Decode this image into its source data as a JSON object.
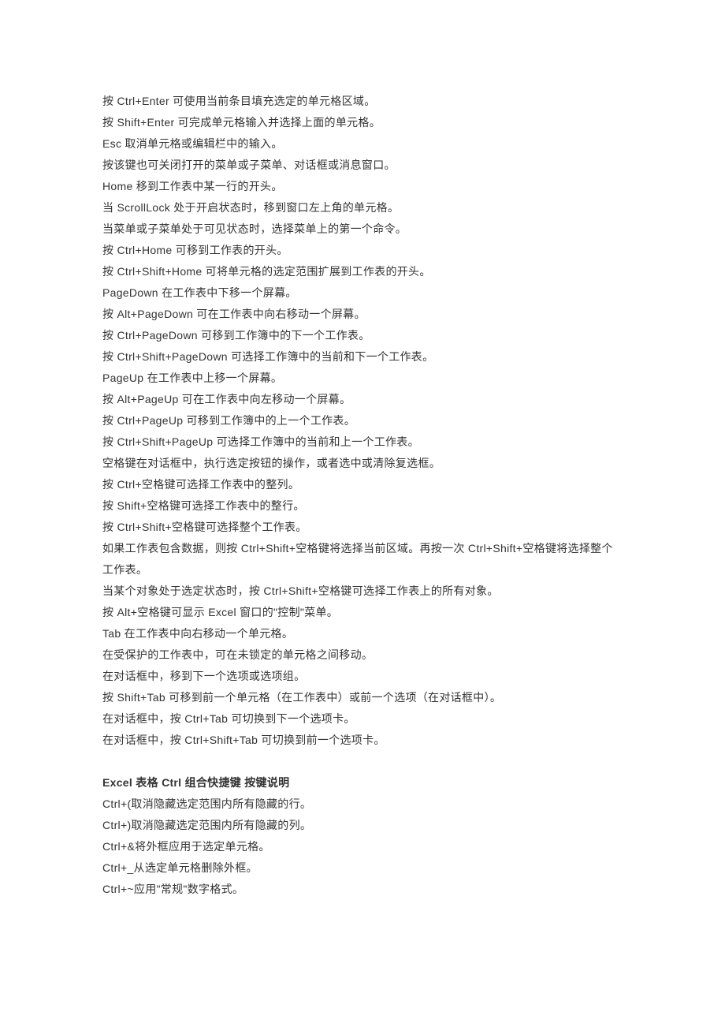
{
  "lines": [
    "按 Ctrl+Enter 可使用当前条目填充选定的单元格区域。",
    "按 Shift+Enter 可完成单元格输入并选择上面的单元格。",
    "Esc 取消单元格或编辑栏中的输入。",
    "按该键也可关闭打开的菜单或子菜单、对话框或消息窗口。",
    "Home 移到工作表中某一行的开头。",
    "当 ScrollLock 处于开启状态时，移到窗口左上角的单元格。",
    "当菜单或子菜单处于可见状态时，选择菜单上的第一个命令。",
    "按 Ctrl+Home 可移到工作表的开头。",
    "按 Ctrl+Shift+Home 可将单元格的选定范围扩展到工作表的开头。",
    "PageDown 在工作表中下移一个屏幕。",
    "按 Alt+PageDown 可在工作表中向右移动一个屏幕。",
    "按 Ctrl+PageDown 可移到工作簿中的下一个工作表。",
    "按 Ctrl+Shift+PageDown 可选择工作簿中的当前和下一个工作表。",
    "PageUp 在工作表中上移一个屏幕。",
    "按 Alt+PageUp 可在工作表中向左移动一个屏幕。",
    "按 Ctrl+PageUp 可移到工作簿中的上一个工作表。",
    "按 Ctrl+Shift+PageUp 可选择工作簿中的当前和上一个工作表。",
    "空格键在对话框中，执行选定按钮的操作，或者选中或清除复选框。",
    "按 Ctrl+空格键可选择工作表中的整列。",
    "按 Shift+空格键可选择工作表中的整行。",
    "按 Ctrl+Shift+空格键可选择整个工作表。",
    "如果工作表包含数据，则按 Ctrl+Shift+空格键将选择当前区域。再按一次 Ctrl+Shift+空格键将选择整个工作表。",
    "当某个对象处于选定状态时，按 Ctrl+Shift+空格键可选择工作表上的所有对象。",
    "按 Alt+空格键可显示 Excel 窗口的\"控制\"菜单。",
    "Tab 在工作表中向右移动一个单元格。",
    "在受保护的工作表中，可在未锁定的单元格之间移动。",
    "在对话框中，移到下一个选项或选项组。",
    "按 Shift+Tab 可移到前一个单元格（在工作表中）或前一个选项（在对话框中）。",
    "在对话框中，按 Ctrl+Tab 可切换到下一个选项卡。",
    "在对话框中，按 Ctrl+Shift+Tab 可切换到前一个选项卡。"
  ],
  "heading": "Excel 表格 Ctrl 组合快捷键 按键说明",
  "lines2": [
    "Ctrl+(取消隐藏选定范围内所有隐藏的行。",
    "Ctrl+)取消隐藏选定范围内所有隐藏的列。",
    "Ctrl+&将外框应用于选定单元格。",
    "Ctrl+_从选定单元格删除外框。",
    "Ctrl+~应用\"常规\"数字格式。"
  ]
}
